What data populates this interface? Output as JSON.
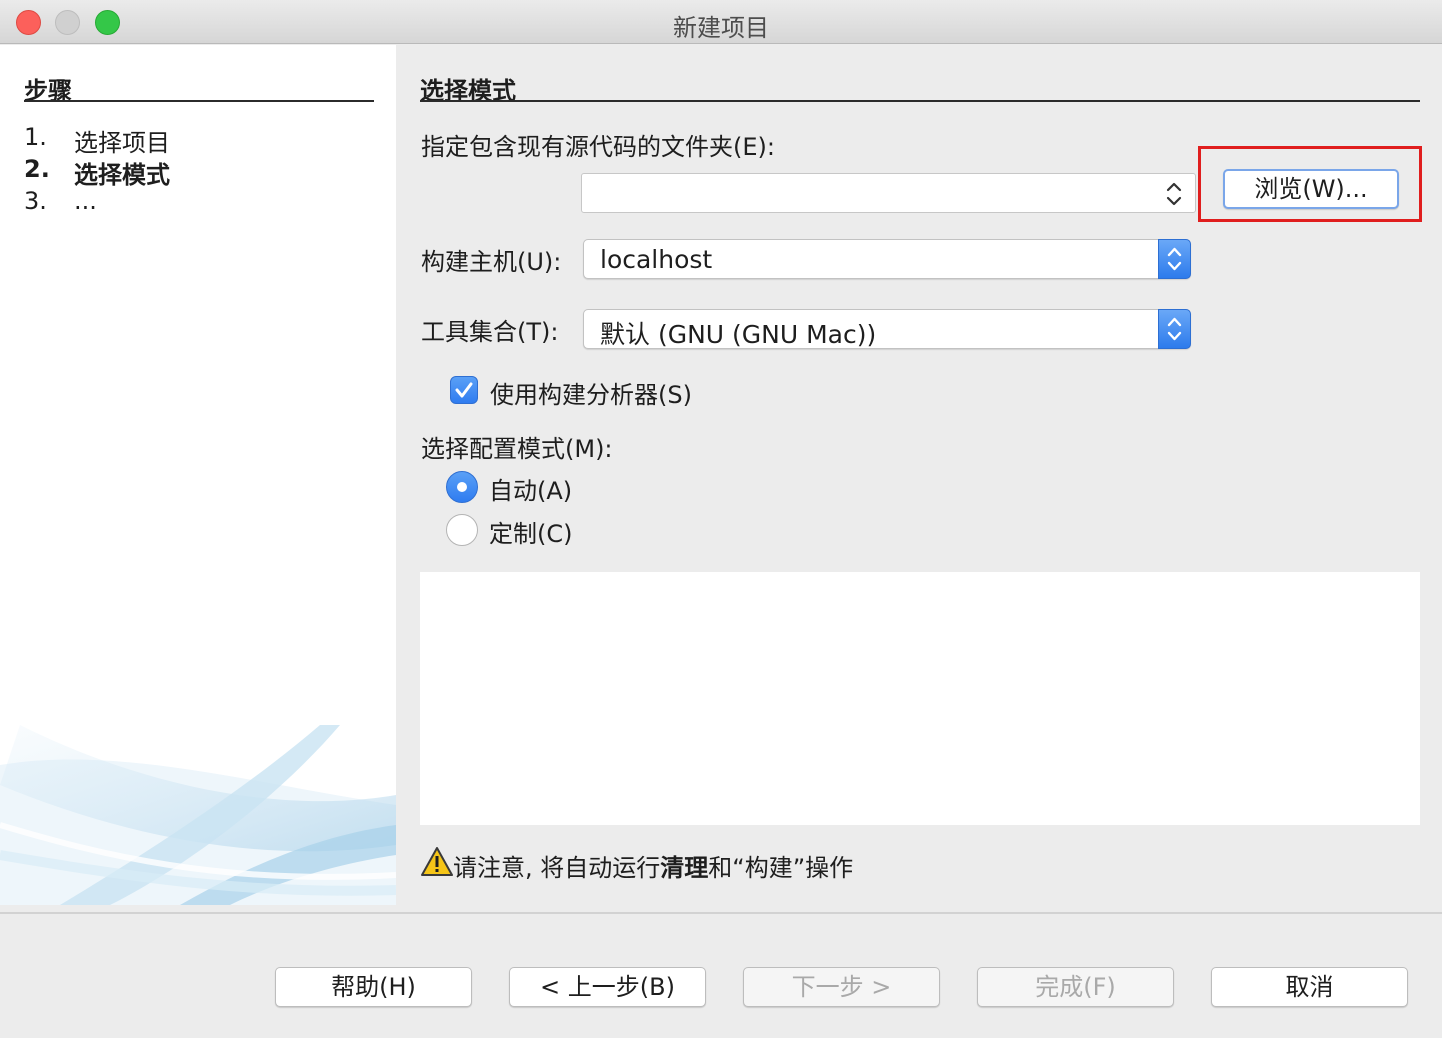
{
  "window": {
    "title": "新建项目"
  },
  "steps": {
    "title": "步骤",
    "items": [
      {
        "num": "1.",
        "label": "选择项目"
      },
      {
        "num": "2.",
        "label": "选择模式"
      },
      {
        "num": "3.",
        "label": "..."
      }
    ]
  },
  "content": {
    "title": "选择模式",
    "folder_label": "指定包含现有源代码的文件夹(E):",
    "folder_value": "",
    "browse_label": "浏览(W)...",
    "build_host_label": "构建主机(U):",
    "build_host_value": "localhost",
    "toolset_label": "工具集合(T):",
    "toolset_value": "默认 (GNU (GNU Mac))",
    "build_analyzer_label": "使用构建分析器(S)",
    "build_analyzer_checked": true,
    "config_mode_label": "选择配置模式(M):",
    "config_modes": [
      {
        "label": "自动(A)",
        "selected": true
      },
      {
        "label": "定制(C)",
        "selected": false
      }
    ],
    "warning_prefix": "请注意, 将自动运行",
    "warning_bold": "清理",
    "warning_suffix": "和“构建”操作"
  },
  "footer": {
    "help": "帮助(H)",
    "back": "< 上一步(B)",
    "next": "下一步 >",
    "finish": "完成(F)",
    "cancel": "取消"
  },
  "colors": {
    "highlight": "#e01e1e",
    "accent": "#2f7cf0"
  }
}
